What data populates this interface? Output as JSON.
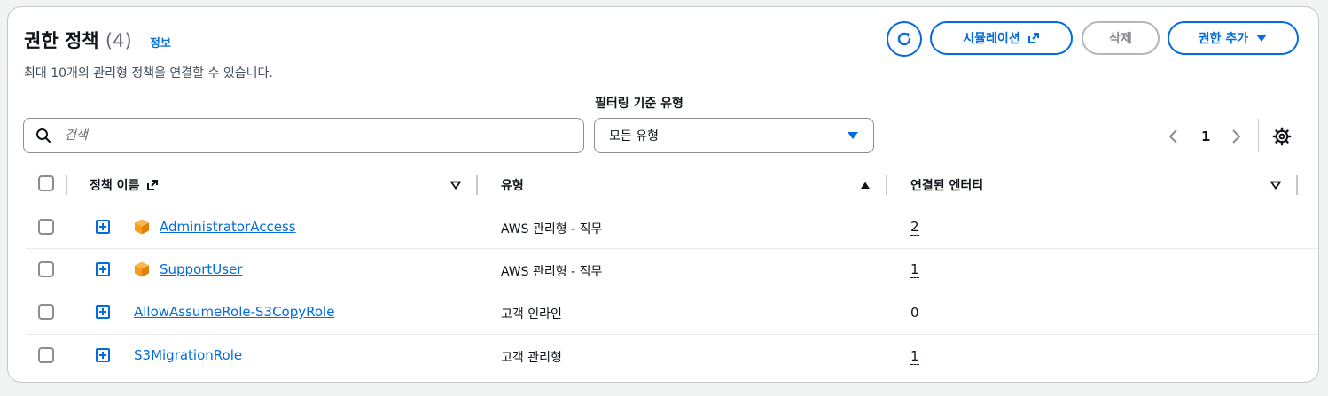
{
  "header": {
    "title": "권한 정책",
    "count": "(4)",
    "info_link": "정보",
    "description": "최대 10개의 관리형 정책을 연결할 수 있습니다."
  },
  "actions": {
    "refresh_icon": "refresh-icon",
    "simulation_label": "시뮬레이션",
    "delete_label": "삭제",
    "add_label": "권한 추가"
  },
  "filter": {
    "search_placeholder": "검색",
    "type_label": "필터링 기준 유형",
    "type_selected": "모든 유형"
  },
  "pagination": {
    "current_page": "1"
  },
  "table": {
    "columns": {
      "name": "정책 이름",
      "type": "유형",
      "entities": "연결된 엔터티"
    },
    "rows": [
      {
        "name": "AdministratorAccess",
        "type": "AWS 관리형 - 직무",
        "entities": "2",
        "aws_managed": true,
        "entities_link": true
      },
      {
        "name": "SupportUser",
        "type": "AWS 관리형 - 직무",
        "entities": "1",
        "aws_managed": true,
        "entities_link": true
      },
      {
        "name": "AllowAssumeRole-S3CopyRole",
        "type": "고객 인라인",
        "entities": "0",
        "aws_managed": false,
        "entities_link": false
      },
      {
        "name": "S3MigrationRole",
        "type": "고객 관리형",
        "entities": "1",
        "aws_managed": false,
        "entities_link": true
      }
    ]
  },
  "colors": {
    "accent": "#006ce0",
    "border": "#c6c6cd",
    "aws_box": "#f89c1c"
  }
}
